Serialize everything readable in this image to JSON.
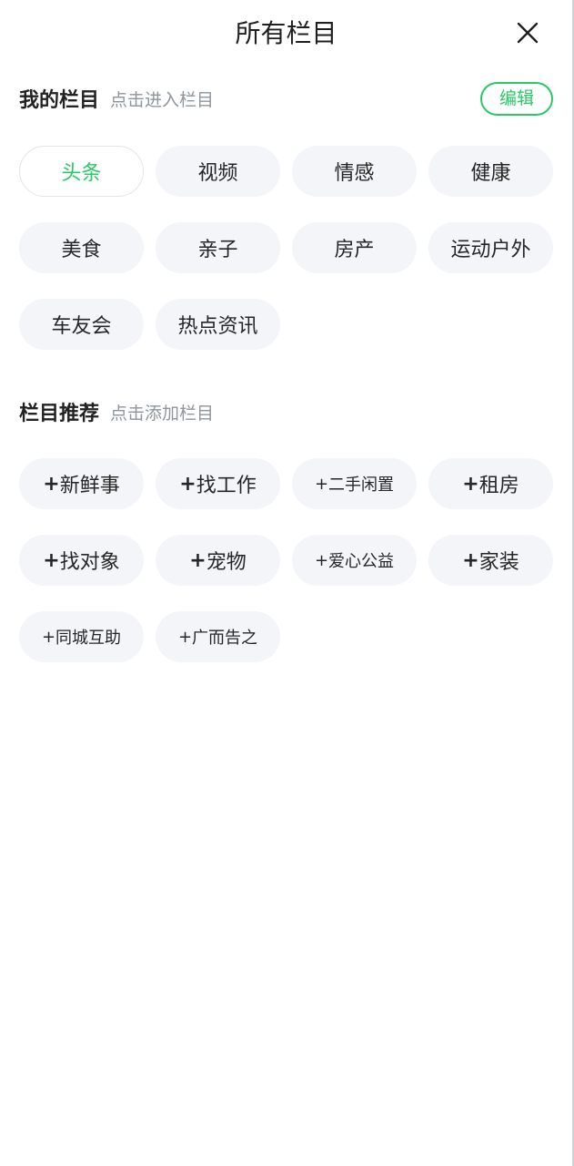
{
  "header": {
    "title": "所有栏目",
    "close_icon": "close-icon"
  },
  "my_channels": {
    "title": "我的栏目",
    "hint": "点击进入栏目",
    "edit_label": "编辑",
    "active_index": 0,
    "items": [
      "头条",
      "视频",
      "情感",
      "健康",
      "美食",
      "亲子",
      "房产",
      "运动户外",
      "车友会",
      "热点资讯"
    ]
  },
  "recommended": {
    "title": "栏目推荐",
    "hint": "点击添加栏目",
    "plus": "+",
    "items": [
      {
        "label": "新鲜事",
        "small": false
      },
      {
        "label": "找工作",
        "small": false
      },
      {
        "label": "二手闲置",
        "small": true
      },
      {
        "label": "租房",
        "small": false
      },
      {
        "label": "找对象",
        "small": false
      },
      {
        "label": "宠物",
        "small": false
      },
      {
        "label": "爱心公益",
        "small": true
      },
      {
        "label": "家装",
        "small": false
      },
      {
        "label": "同城互助",
        "small": true
      },
      {
        "label": "广而告之",
        "small": true
      }
    ]
  },
  "colors": {
    "accent": "#2bc867",
    "chip_bg": "#f4f5f8",
    "hint_text": "#8e959c"
  }
}
